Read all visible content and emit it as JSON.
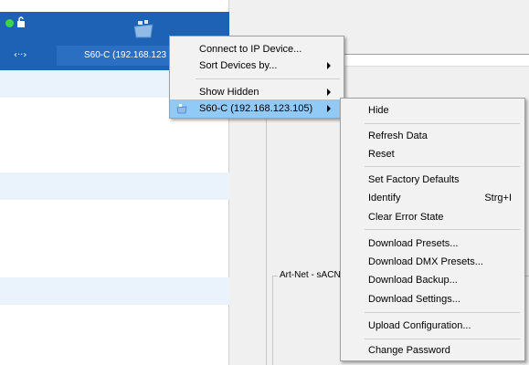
{
  "device": {
    "name": "S60-C (192.168.123",
    "net_symbol": "‹··›"
  },
  "group_label": "Art-Net - sACN",
  "context_menu": {
    "items": [
      {
        "label": "Connect to IP Device...",
        "submenu": false
      },
      {
        "label": "Sort Devices by...",
        "submenu": true
      },
      {
        "label": "Show Hidden",
        "submenu": true
      },
      {
        "label": "S60-C (192.168.123.105)",
        "submenu": true,
        "highlighted": true
      }
    ]
  },
  "device_submenu": {
    "items": [
      {
        "label": "Hide"
      },
      {
        "label": "Refresh Data"
      },
      {
        "label": "Reset"
      },
      {
        "label": "Set Factory Defaults"
      },
      {
        "label": "Identify",
        "shortcut": "Strg+I"
      },
      {
        "label": "Clear Error State"
      },
      {
        "label": "Download Presets..."
      },
      {
        "label": "Download DMX Presets..."
      },
      {
        "label": "Download Backup..."
      },
      {
        "label": "Download Settings..."
      },
      {
        "label": "Upload Configuration..."
      },
      {
        "label": "Change Password"
      }
    ]
  },
  "colors": {
    "header_blue": "#1e62b5",
    "status_online": "#3ed34d",
    "menu_highlight": "#91c9f7",
    "stripe": "#eaf2fb"
  },
  "icons": {
    "status": "status-dot-icon",
    "lock": "lock-icon",
    "device": "device-icon",
    "network": "network-icon",
    "submenu_arrow": "chevron-right-icon"
  }
}
